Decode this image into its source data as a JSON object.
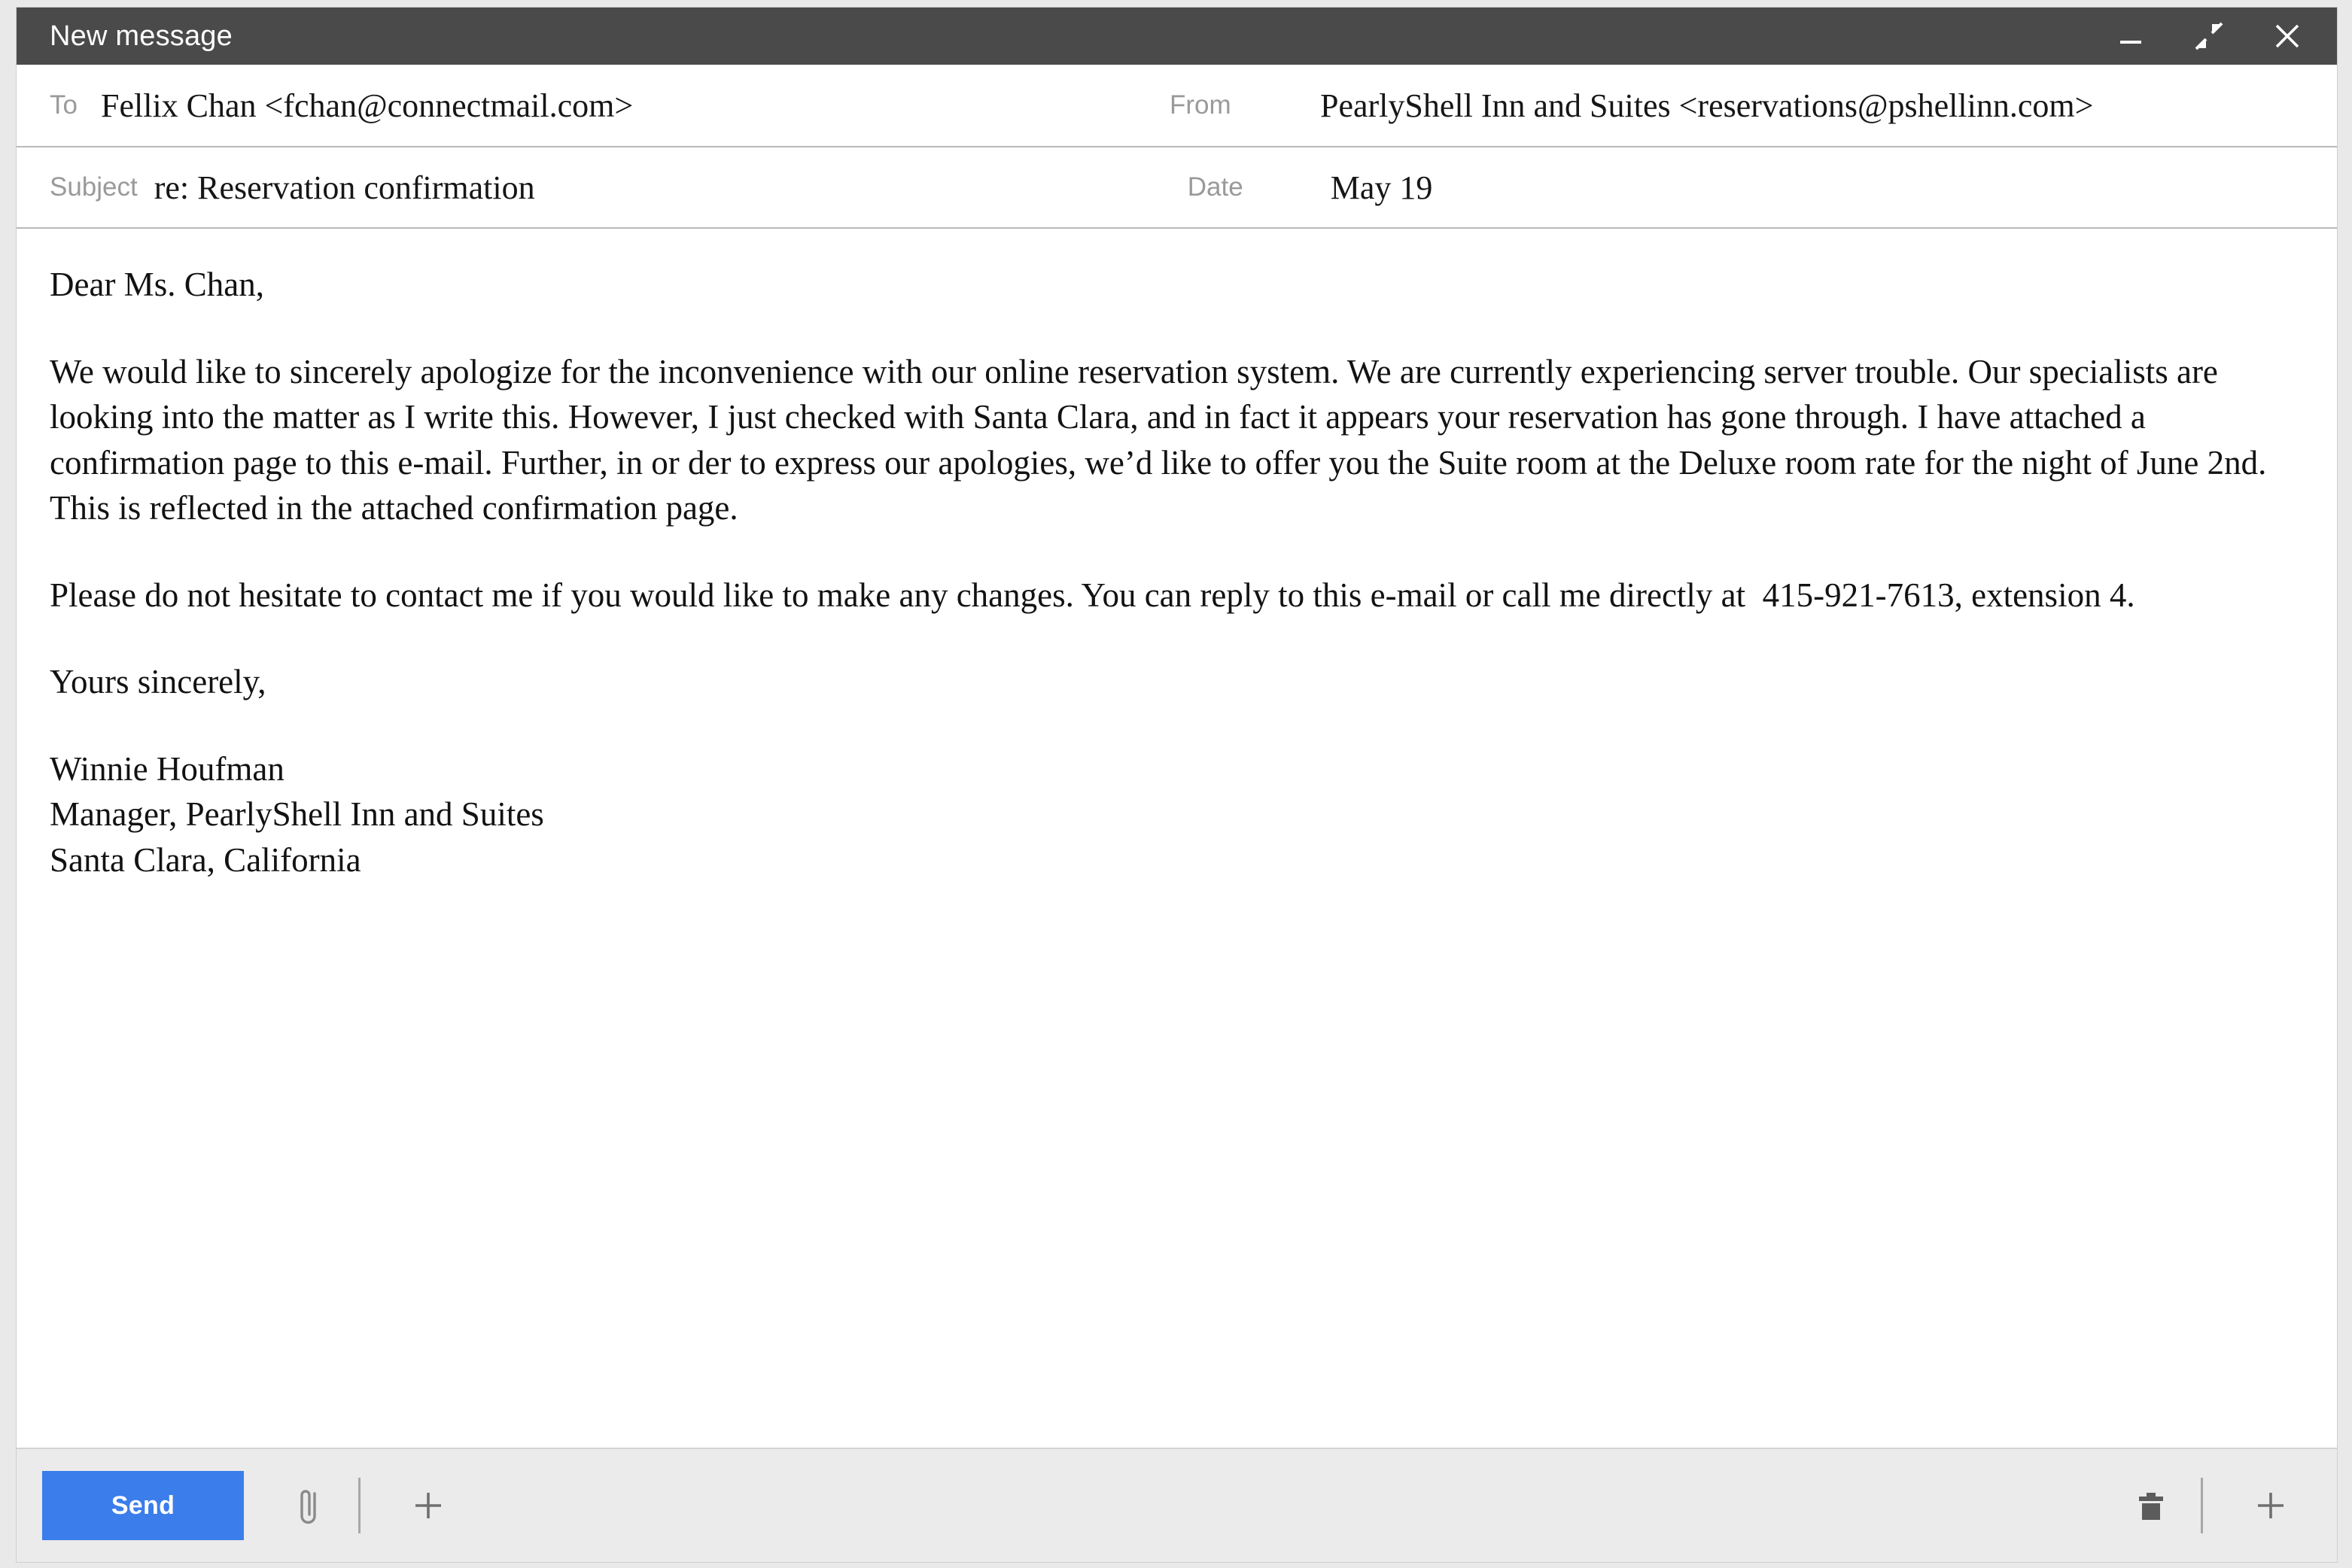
{
  "window": {
    "title": "New message",
    "controls": [
      {
        "name": "minimize",
        "glyph": "minimize-icon"
      },
      {
        "name": "restore",
        "glyph": "exit-fullscreen-icon"
      },
      {
        "name": "close",
        "glyph": "close-icon"
      }
    ],
    "titlebar_bg": "#4a4a4a",
    "accent": "#3b7dea"
  },
  "header": {
    "to_label": "To",
    "to_value": "Fellix Chan <fchan@connectmail.com>",
    "from_label": "From",
    "from_value": "PearlyShell Inn and Suites <reservations@pshellinn.com>",
    "subject_label": "Subject",
    "subject_value": "re: Reservation confirmation",
    "date_label": "Date",
    "date_value": "May 19"
  },
  "body": {
    "greeting": "Dear Ms. Chan,",
    "paragraph_1": "We would like to sincerely apologize for the inconvenience with our online reservation system. We are currently experiencing server trouble. Our specialists are looking into the matter as I write this. However, I just checked with Santa Clara, and in fact it appears your reservation has gone through. I have attached a confirmation page to this e-mail. Further, in or der to express our apologies, we’d like to offer you the Suite room at the Deluxe room rate for the night of June 2nd. This is reflected in the attached confirmation page.",
    "paragraph_2": "Please do not hesitate to contact me if you would like to make any changes. You can reply to this e-mail or call me directly at  415-921-7613, extension 4.",
    "closing": "Yours sincerely,",
    "signature_name": "Winnie Houfman",
    "signature_title": "Manager, PearlyShell Inn and Suites",
    "signature_location": "Santa Clara, California"
  },
  "toolbar": {
    "send_label": "Send",
    "attach_icon": "paperclip-icon",
    "add_left_icon": "plus-icon",
    "delete_icon": "trash-icon",
    "add_right_icon": "plus-icon"
  }
}
